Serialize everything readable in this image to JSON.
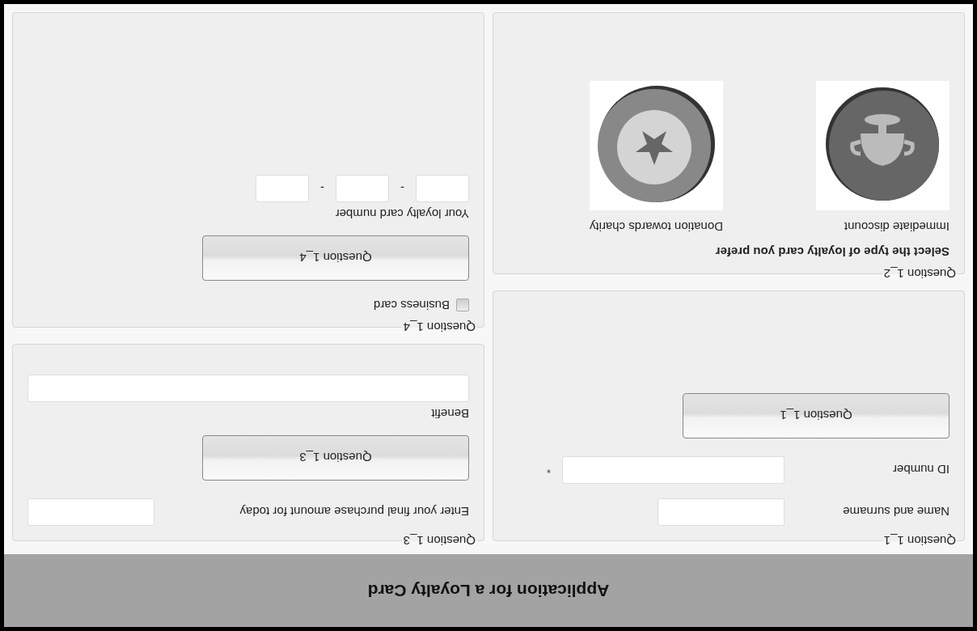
{
  "title": "Application for a Loyalty Card",
  "columns": [
    [
      {
        "legend": "Question 1_1",
        "items": [
          {
            "kind": "field",
            "label": "Name and surname"
          },
          {
            "kind": "field",
            "label": "ID number",
            "required_mark": "*"
          },
          {
            "kind": "button",
            "label": "Question 1_1"
          }
        ]
      },
      {
        "legend": "Question 1_2",
        "items": [
          {
            "kind": "heading",
            "text": "Select the type of loyalty card you prefer"
          },
          {
            "kind": "choices",
            "options": [
              {
                "label": "Immediate discount"
              },
              {
                "label": "Donation towards charity"
              }
            ]
          }
        ]
      }
    ],
    [
      {
        "legend": "Question 1_3",
        "items": [
          {
            "kind": "field",
            "label": "Enter your final purchase amount for today"
          },
          {
            "kind": "button",
            "label": "Question 1_3"
          },
          {
            "kind": "wide_field",
            "label": "Benefit"
          }
        ]
      },
      {
        "legend": "Question 1_4",
        "items": [
          {
            "kind": "checkbox",
            "label": "Business card",
            "checked": false
          },
          {
            "kind": "button",
            "label": "Question 1_4"
          },
          {
            "kind": "split_field",
            "label": "Your loyalty card number",
            "separators": [
              "-",
              "-"
            ]
          }
        ]
      }
    ]
  ]
}
